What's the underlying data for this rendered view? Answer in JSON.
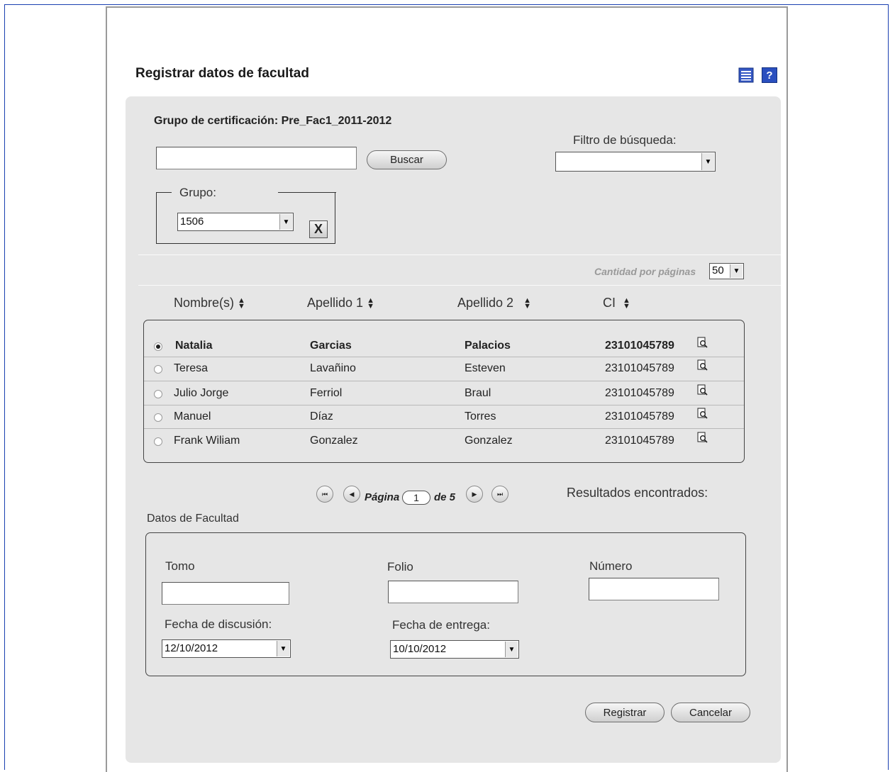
{
  "page": {
    "title": "Registrar datos de facultad"
  },
  "header_icons": {
    "list": "list-icon",
    "help": "help-icon",
    "help_glyph": "?"
  },
  "search": {
    "group_label": "Grupo de certificación: Pre_Fac1_2011-2012",
    "query": "",
    "button": "Buscar",
    "filter_label": "Filtro de búsqueda:",
    "filter_value": ""
  },
  "grupo": {
    "legend": "Grupo:",
    "value": "1506",
    "clear": "X"
  },
  "pagination_top": {
    "per_page_label": "Cantidad por páginas",
    "per_page": "50"
  },
  "table": {
    "headers": [
      "Nombre(s)",
      "Apellido 1",
      "Apellido 2",
      "CI"
    ],
    "rows": [
      {
        "nombre": "Natalia",
        "ap1": "Garcias",
        "ap2": "Palacios",
        "ci": "23101045789",
        "selected": true
      },
      {
        "nombre": "Teresa",
        "ap1": "Lavañino",
        "ap2": "Esteven",
        "ci": "23101045789",
        "selected": false
      },
      {
        "nombre": "Julio Jorge",
        "ap1": "Ferriol",
        "ap2": "Braul",
        "ci": "23101045789",
        "selected": false
      },
      {
        "nombre": "Manuel",
        "ap1": "Díaz",
        "ap2": "Torres",
        "ci": "23101045789",
        "selected": false
      },
      {
        "nombre": "Frank Wiliam",
        "ap1": "Gonzalez",
        "ap2": "Gonzalez",
        "ci": "23101045789",
        "selected": false
      }
    ]
  },
  "pager": {
    "label": "Página",
    "current": "1",
    "of_label": "de 5",
    "results_label": "Resultados encontrados:"
  },
  "datos": {
    "section_label": "Datos de Facultad",
    "tomo_label": "Tomo",
    "tomo": "",
    "folio_label": "Folio",
    "folio": "",
    "numero_label": "Número",
    "numero": "",
    "fecha_discusion_label": "Fecha de discusión:",
    "fecha_discusion": "12/10/2012",
    "fecha_entrega_label": "Fecha de entrega:",
    "fecha_entrega": "10/10/2012"
  },
  "actions": {
    "register": "Registrar",
    "cancel": "Cancelar"
  },
  "colors": {
    "frame": "#1a3fb0",
    "panel": "#e6e6e6",
    "help": "#2a4fbf"
  }
}
